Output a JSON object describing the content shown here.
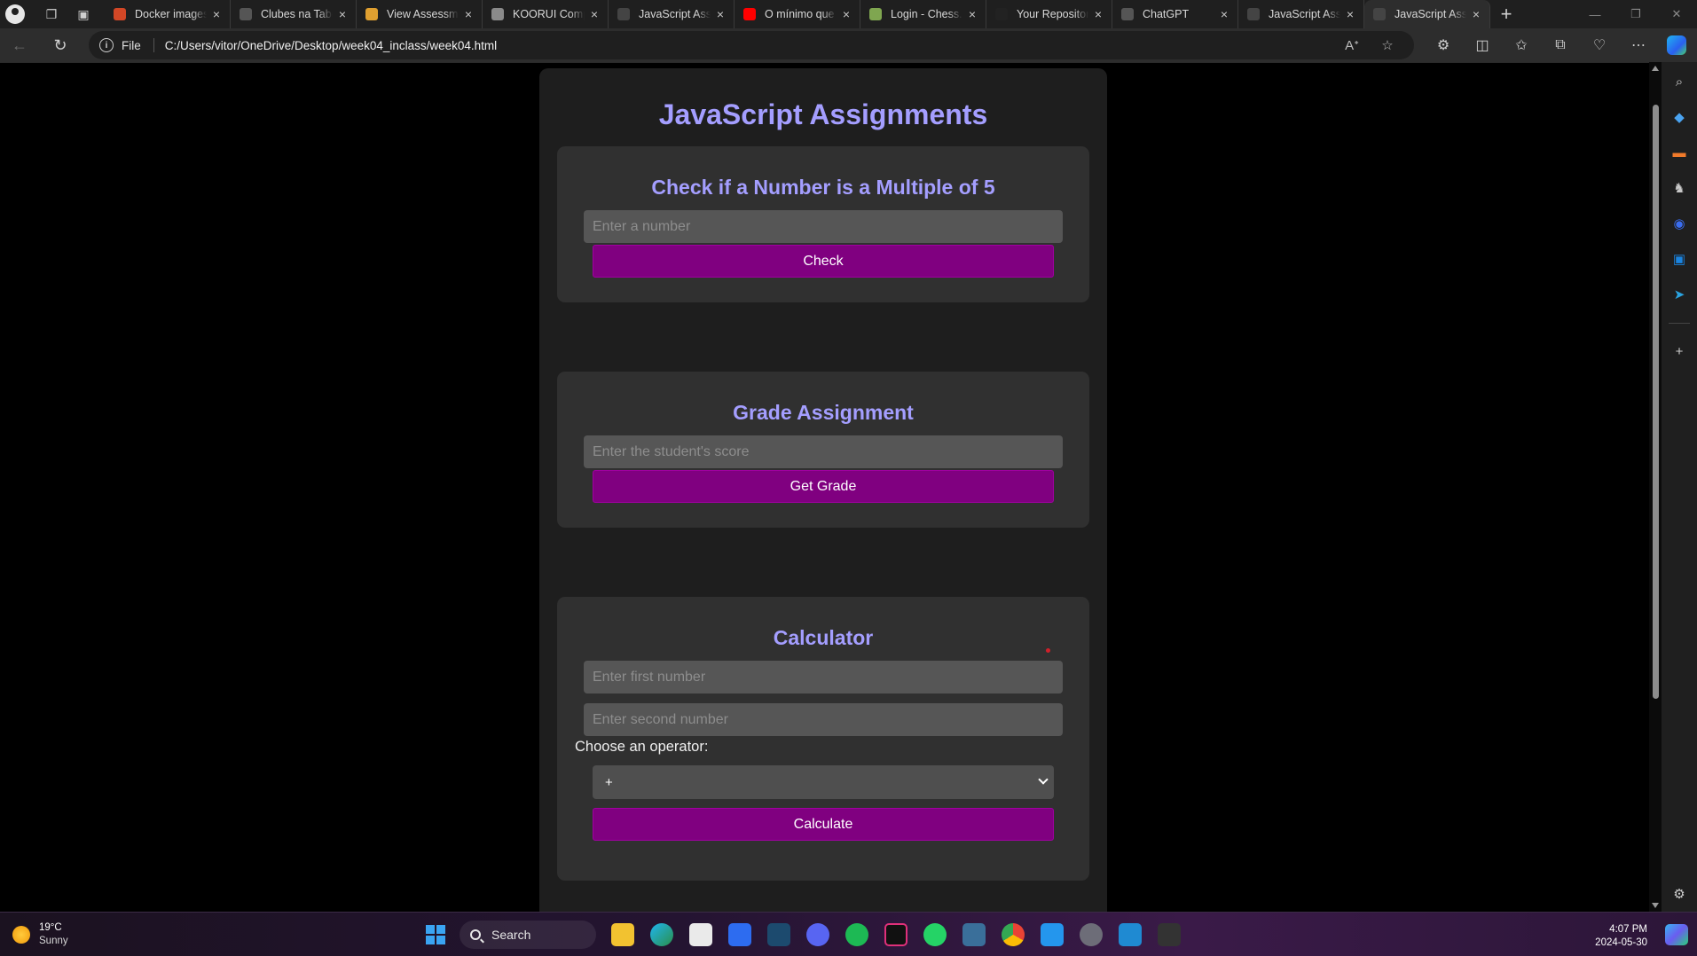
{
  "browser": {
    "tabs": [
      {
        "label": "Docker images",
        "icon": "ms-store-icon",
        "color": "#d24726"
      },
      {
        "label": "Clubes na Tabela",
        "icon": "chatgpt-icon",
        "color": "#555555"
      },
      {
        "label": "View Assessment",
        "icon": "chart-icon",
        "color": "#e0a030"
      },
      {
        "label": "KOORUI Computer",
        "icon": "store-icon",
        "color": "#8a8a8a"
      },
      {
        "label": "JavaScript Assignments",
        "icon": "file-icon",
        "color": "#444444"
      },
      {
        "label": "O mínimo que",
        "icon": "youtube-icon",
        "color": "#ff0000"
      },
      {
        "label": "Login - Chess.com",
        "icon": "chess-icon",
        "color": "#7fa650"
      },
      {
        "label": "Your Repositories",
        "icon": "github-icon",
        "color": "#222222"
      },
      {
        "label": "ChatGPT",
        "icon": "chatgpt-icon",
        "color": "#555555"
      },
      {
        "label": "JavaScript Assignments",
        "icon": "file-icon",
        "color": "#444444"
      },
      {
        "label": "JavaScript Assignments",
        "icon": "file-icon",
        "color": "#444444"
      }
    ],
    "active_tab": 10,
    "address": {
      "scheme": "File",
      "url": "C:/Users/vitor/OneDrive/Desktop/week04_inclass/week04.html"
    }
  },
  "page": {
    "title": "JavaScript Assignments",
    "multiple_of_5": {
      "heading": "Check if a Number is a Multiple of 5",
      "input_placeholder": "Enter a number",
      "button_label": "Check"
    },
    "grade": {
      "heading": "Grade Assignment",
      "input_placeholder": "Enter the student's score",
      "button_label": "Get Grade"
    },
    "calculator": {
      "heading": "Calculator",
      "first_placeholder": "Enter first number",
      "second_placeholder": "Enter second number",
      "operator_label": "Choose an operator:",
      "operator_selected": "+",
      "button_label": "Calculate"
    }
  },
  "taskbar": {
    "weather": {
      "temp": "19°C",
      "condition": "Sunny"
    },
    "search_label": "Search",
    "clock": {
      "time": "4:07 PM",
      "date": "2024-05-30"
    }
  },
  "colors": {
    "accent_heading": "#a49eff",
    "button_purple": "#800080",
    "card_bg": "#303030",
    "container_bg": "#1e1e1e"
  }
}
